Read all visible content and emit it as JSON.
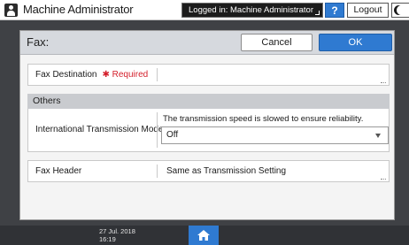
{
  "topbar": {
    "title": "Machine Administrator",
    "logged_in_text": "Logged in: Machine Administrator",
    "help_label": "?",
    "logout_label": "Logout"
  },
  "dialog": {
    "title": "Fax:",
    "cancel_label": "Cancel",
    "ok_label": "OK",
    "fax_destination": {
      "label": "Fax Destination",
      "required_text": "✱ Required",
      "value": ""
    },
    "section_others": "Others",
    "international_mode": {
      "label": "International Transmission Mode",
      "note": "The transmission speed is slowed to ensure reliability.",
      "selected": "Off"
    },
    "fax_header": {
      "label": "Fax Header",
      "value": "Same as Transmission Setting"
    }
  },
  "bottombar": {
    "date": "27 Jul. 2018",
    "time": "16:19"
  },
  "colors": {
    "accent_blue": "#2f7ad1",
    "required_red": "#d4202c",
    "background": "#3f4145"
  },
  "icons": {
    "user": "user-icon",
    "home": "home-icon",
    "moon": "moon-icon"
  }
}
